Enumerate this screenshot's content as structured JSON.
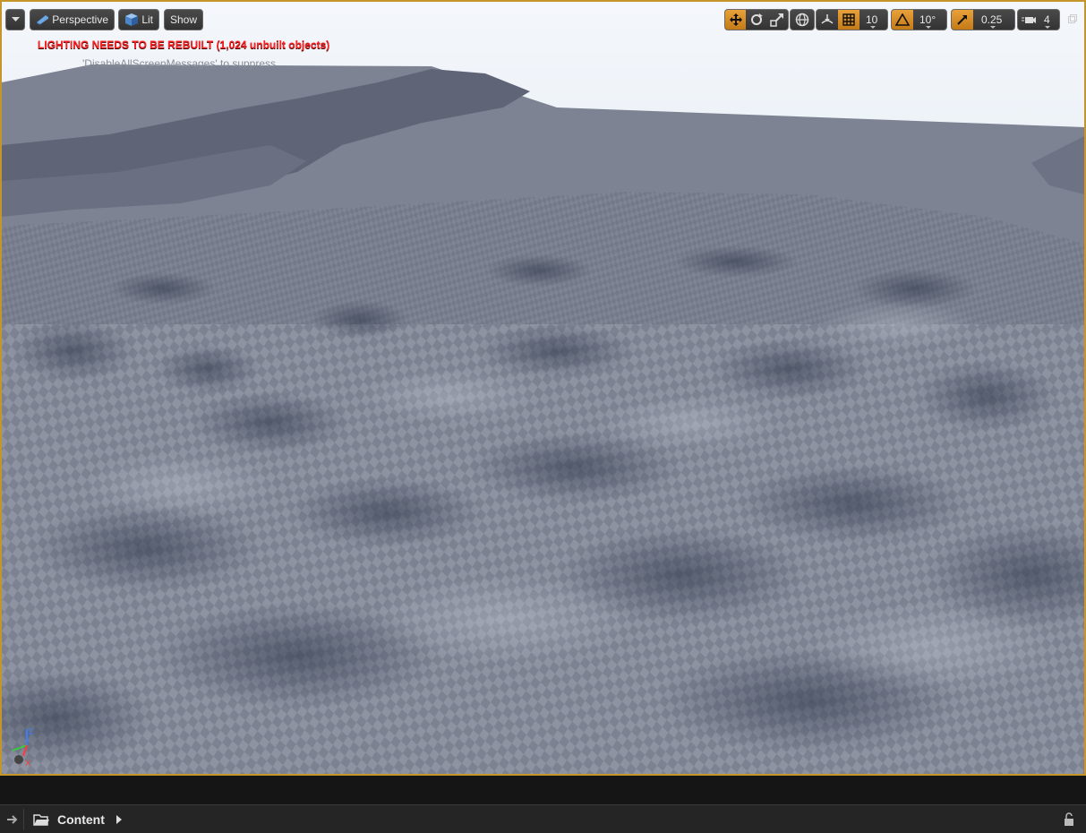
{
  "viewport": {
    "menu_label": "",
    "perspective_label": "Perspective",
    "lit_label": "Lit",
    "show_label": "Show",
    "grid_snap_value": "10",
    "rotation_snap_value": "10°",
    "scale_snap_value": "0.25",
    "camera_speed_value": "4",
    "lighting_warning": "LIGHTING NEEDS TO BE REBUILT (1,024 unbuilt objects)",
    "suppress_hint": "'DisableAllScreenMessages' to suppress",
    "axis_labels": {
      "z": "Z",
      "x": "X"
    },
    "colors": {
      "accent": "#c5952a",
      "warning": "#ff2020",
      "sky": "#dde8f3"
    }
  },
  "content_browser": {
    "path_label": "Content"
  }
}
